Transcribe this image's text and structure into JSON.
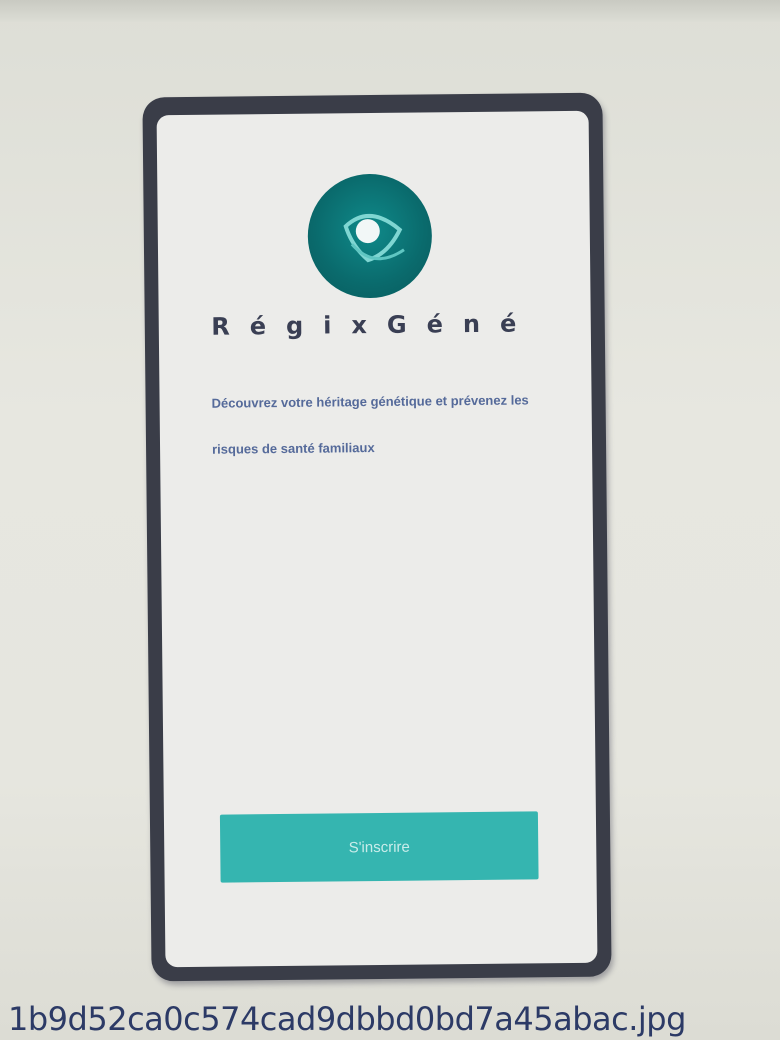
{
  "app": {
    "brand_name": "RégixGéné",
    "logo_icon": "eye-icon",
    "accent_color": "#35b5b0",
    "logo_color": "#0a6a6c"
  },
  "welcome": {
    "tagline": "Découvrez votre héritage génétique et prévenez les risques de santé familiaux"
  },
  "actions": {
    "primary_label": "S'inscrire"
  },
  "photo": {
    "filename": "1b9d52ca0c574cad9dbbd0bd7a45abac.jpg"
  }
}
